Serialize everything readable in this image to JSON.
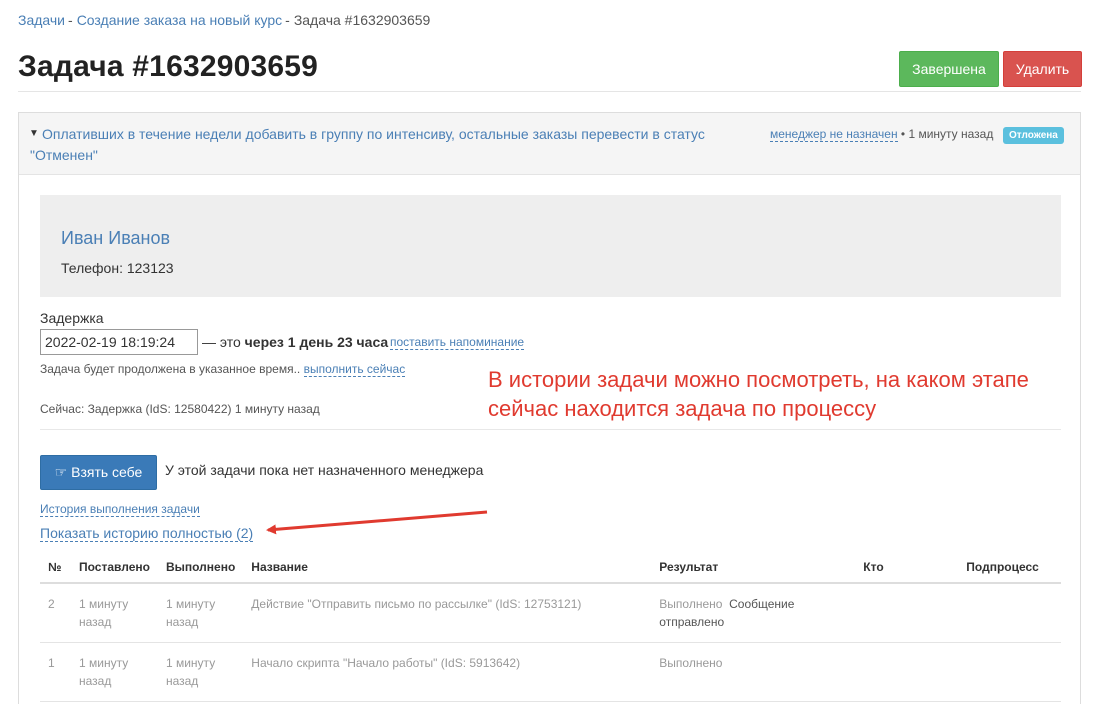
{
  "breadcrumb": {
    "items": [
      "Задачи",
      "Создание заказа на новый курс"
    ],
    "separator": "-",
    "current": "Задача #1632903659"
  },
  "page_title": "Задача #1632903659",
  "actions": {
    "done_label": "Завершена",
    "delete_label": "Удалить"
  },
  "panel_header": {
    "title": "Оплативших в течение недели добавить в группу по интенсиву, остальные заказы перевести в статус \"Отменен\"",
    "manager_link": "менеджер не назначен",
    "time": "• 1 минуту назад",
    "status_badge": "Отложена"
  },
  "contact": {
    "name": "Иван Иванов",
    "phone": "Телефон: 123123"
  },
  "delay": {
    "label": "Задержка",
    "value": "2022-02-19 18:19:24",
    "prefix": "— это",
    "bold": "через 1 день 23 часа",
    "remind_link": "поставить напоминание",
    "note": "Задача будет продолжена в указанное время..",
    "run_now_link": "выполнить сейчас"
  },
  "status_now": "Сейчас: Задержка (IdS: 12580422) 1 минуту назад",
  "take_button": "Взять себе",
  "no_manager_text": "У этой задачи пока нет назначенного менеджера",
  "history_link": "История выполнения задачи",
  "show_history_link": "Показать историю полностью (2)",
  "annotation": "В истории задачи можно посмотреть, на каком этапе сейчас находится задача по процессу",
  "table": {
    "headers": [
      "№",
      "Поставлено",
      "Выполнено",
      "Название",
      "Результат",
      "Кто",
      "Подпроцесс"
    ],
    "rows": [
      {
        "num": "2",
        "set": "1 минуту назад",
        "done": "1 минуту назад",
        "name": "Действие \"Отправить письмо по рассылке\" (IdS: 12753121)",
        "result": "Выполнено",
        "result_extra": "Сообщение отправлено",
        "who": "",
        "subprocess": ""
      },
      {
        "num": "1",
        "set": "1 минуту назад",
        "done": "1 минуту назад",
        "name": "Начало скрипта \"Начало работы\" (IdS: 5913642)",
        "result": "Выполнено",
        "result_extra": "",
        "who": "",
        "subprocess": ""
      }
    ]
  },
  "colors": {
    "link": "#4a7fb5",
    "success": "#5cb85c",
    "danger": "#d9534f",
    "primary": "#3a7ab8",
    "info_badge": "#5bc0de",
    "annotation": "#e03a2f"
  },
  "icons": {
    "caret": "caret-down-icon",
    "take": "thumbs-up-icon"
  }
}
